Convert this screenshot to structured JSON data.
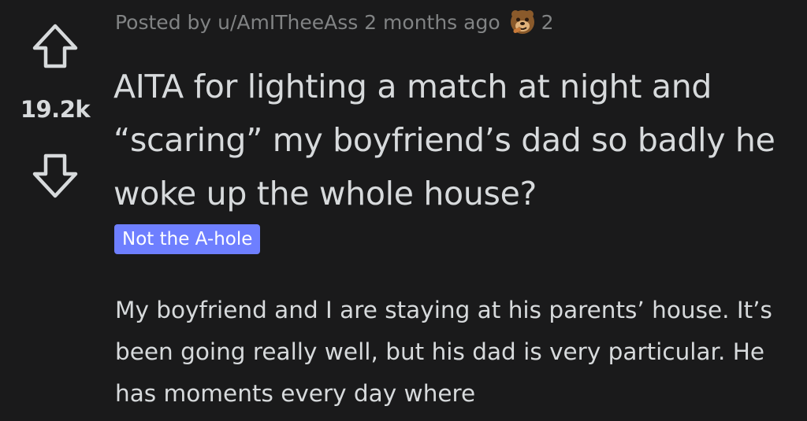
{
  "post": {
    "meta": "Posted by u/AmITheeAss 2 months ago",
    "award_icon": "award-icon",
    "award_count": "2",
    "score": "19.2k",
    "title": "AITA for lighting a match at night and “scaring” my boyfriend’s dad so badly he woke up the whole house?",
    "flair": "Not the A-hole",
    "body": "My boyfriend and I are staying at his parents’ house. It’s been going really well, but his dad is very particular. He has moments every day where"
  },
  "icons": {
    "upvote": "upvote-arrow-icon",
    "downvote": "downvote-arrow-icon"
  },
  "colors": {
    "background": "#1a1a1b",
    "text": "#d7dadc",
    "meta_text": "#818384",
    "flair_bg": "#6e7fff"
  }
}
